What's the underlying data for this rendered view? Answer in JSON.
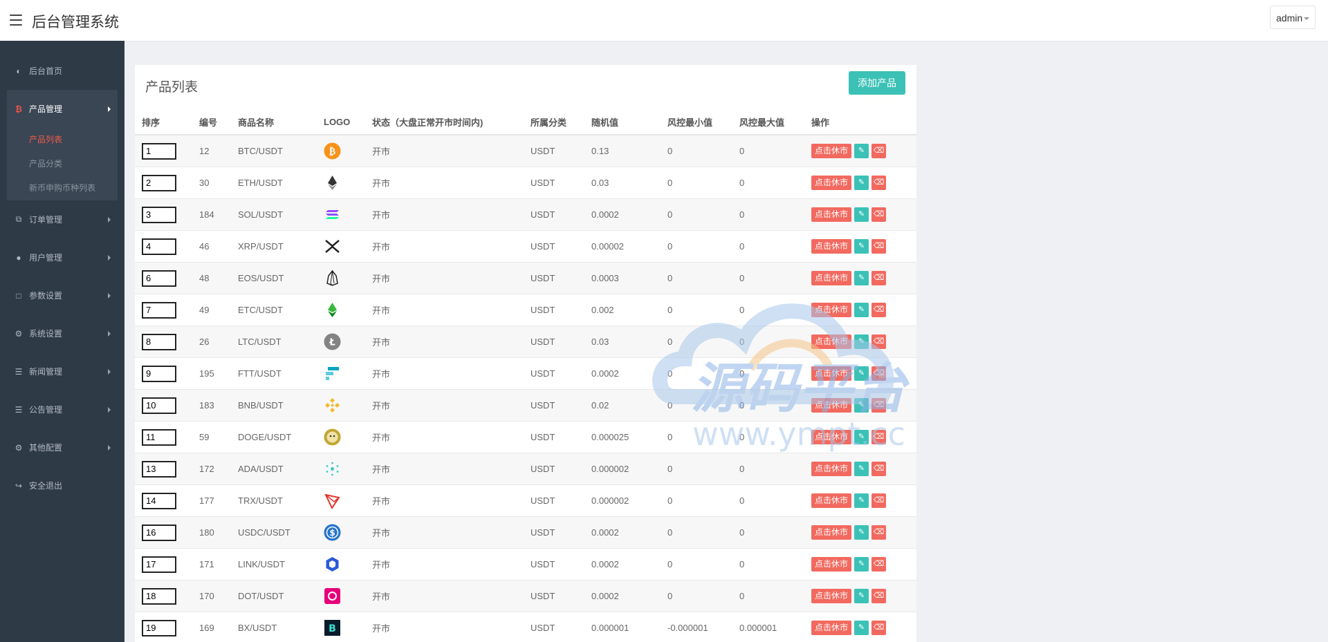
{
  "header": {
    "title": "后台管理系统",
    "user": "admin"
  },
  "sidebar": {
    "items": [
      {
        "label": "后台首页",
        "icon": "dashboard-icon"
      },
      {
        "label": "产品管理",
        "icon": "bitcoin-icon",
        "expanded": true,
        "children": [
          {
            "label": "产品列表",
            "active": true
          },
          {
            "label": "产品分类"
          },
          {
            "label": "新币申购币种列表"
          }
        ]
      },
      {
        "label": "订单管理",
        "icon": "copy-icon"
      },
      {
        "label": "用户管理",
        "icon": "user-icon"
      },
      {
        "label": "参数设置",
        "icon": "file-icon"
      },
      {
        "label": "系统设置",
        "icon": "cogs-icon"
      },
      {
        "label": "新闻管理",
        "icon": "list-icon"
      },
      {
        "label": "公告管理",
        "icon": "list-icon"
      },
      {
        "label": "其他配置",
        "icon": "gear-icon"
      },
      {
        "label": "安全退出",
        "icon": "sign-out-icon"
      }
    ]
  },
  "panel": {
    "title": "产品列表",
    "add_button": "添加产品",
    "columns": [
      "排序",
      "编号",
      "商品名称",
      "LOGO",
      "状态（大盘正常开市时间内)",
      "所属分类",
      "随机值",
      "风控最小值",
      "风控最大值",
      "操作"
    ],
    "actions": {
      "close_market": "点击休市",
      "edit_icon": "pencil-icon",
      "delete_icon": "trash-icon"
    },
    "rows": [
      {
        "sort": "1",
        "id": "12",
        "name": "BTC/USDT",
        "logo": "btc-logo",
        "status": "开市",
        "category": "USDT",
        "random": "0.13",
        "min": "0",
        "max": "0"
      },
      {
        "sort": "2",
        "id": "30",
        "name": "ETH/USDT",
        "logo": "eth-logo",
        "status": "开市",
        "category": "USDT",
        "random": "0.03",
        "min": "0",
        "max": "0"
      },
      {
        "sort": "3",
        "id": "184",
        "name": "SOL/USDT",
        "logo": "sol-logo",
        "status": "开市",
        "category": "USDT",
        "random": "0.0002",
        "min": "0",
        "max": "0"
      },
      {
        "sort": "4",
        "id": "46",
        "name": "XRP/USDT",
        "logo": "xrp-logo",
        "status": "开市",
        "category": "USDT",
        "random": "0.00002",
        "min": "0",
        "max": "0"
      },
      {
        "sort": "6",
        "id": "48",
        "name": "EOS/USDT",
        "logo": "eos-logo",
        "status": "开市",
        "category": "USDT",
        "random": "0.0003",
        "min": "0",
        "max": "0"
      },
      {
        "sort": "7",
        "id": "49",
        "name": "ETC/USDT",
        "logo": "etc-logo",
        "status": "开市",
        "category": "USDT",
        "random": "0.002",
        "min": "0",
        "max": "0"
      },
      {
        "sort": "8",
        "id": "26",
        "name": "LTC/USDT",
        "logo": "ltc-logo",
        "status": "开市",
        "category": "USDT",
        "random": "0.03",
        "min": "0",
        "max": "0"
      },
      {
        "sort": "9",
        "id": "195",
        "name": "FTT/USDT",
        "logo": "ftt-logo",
        "status": "开市",
        "category": "USDT",
        "random": "0.0002",
        "min": "0",
        "max": "0"
      },
      {
        "sort": "10",
        "id": "183",
        "name": "BNB/USDT",
        "logo": "bnb-logo",
        "status": "开市",
        "category": "USDT",
        "random": "0.02",
        "min": "0",
        "max": "0"
      },
      {
        "sort": "11",
        "id": "59",
        "name": "DOGE/USDT",
        "logo": "doge-logo",
        "status": "开市",
        "category": "USDT",
        "random": "0.000025",
        "min": "0",
        "max": "0"
      },
      {
        "sort": "13",
        "id": "172",
        "name": "ADA/USDT",
        "logo": "ada-logo",
        "status": "开市",
        "category": "USDT",
        "random": "0.000002",
        "min": "0",
        "max": "0"
      },
      {
        "sort": "14",
        "id": "177",
        "name": "TRX/USDT",
        "logo": "trx-logo",
        "status": "开市",
        "category": "USDT",
        "random": "0.000002",
        "min": "0",
        "max": "0"
      },
      {
        "sort": "16",
        "id": "180",
        "name": "USDC/USDT",
        "logo": "usdc-logo",
        "status": "开市",
        "category": "USDT",
        "random": "0.0002",
        "min": "0",
        "max": "0"
      },
      {
        "sort": "17",
        "id": "171",
        "name": "LINK/USDT",
        "logo": "link-logo",
        "status": "开市",
        "category": "USDT",
        "random": "0.0002",
        "min": "0",
        "max": "0"
      },
      {
        "sort": "18",
        "id": "170",
        "name": "DOT/USDT",
        "logo": "dot-logo",
        "status": "开市",
        "category": "USDT",
        "random": "0.0002",
        "min": "0",
        "max": "0"
      },
      {
        "sort": "19",
        "id": "169",
        "name": "BX/USDT",
        "logo": "bx-logo",
        "status": "开市",
        "category": "USDT",
        "random": "0.000001",
        "min": "-0.000001",
        "max": "0.000001"
      }
    ]
  },
  "watermark": {
    "text": "源码平台",
    "url": "www.ympt.cc"
  }
}
